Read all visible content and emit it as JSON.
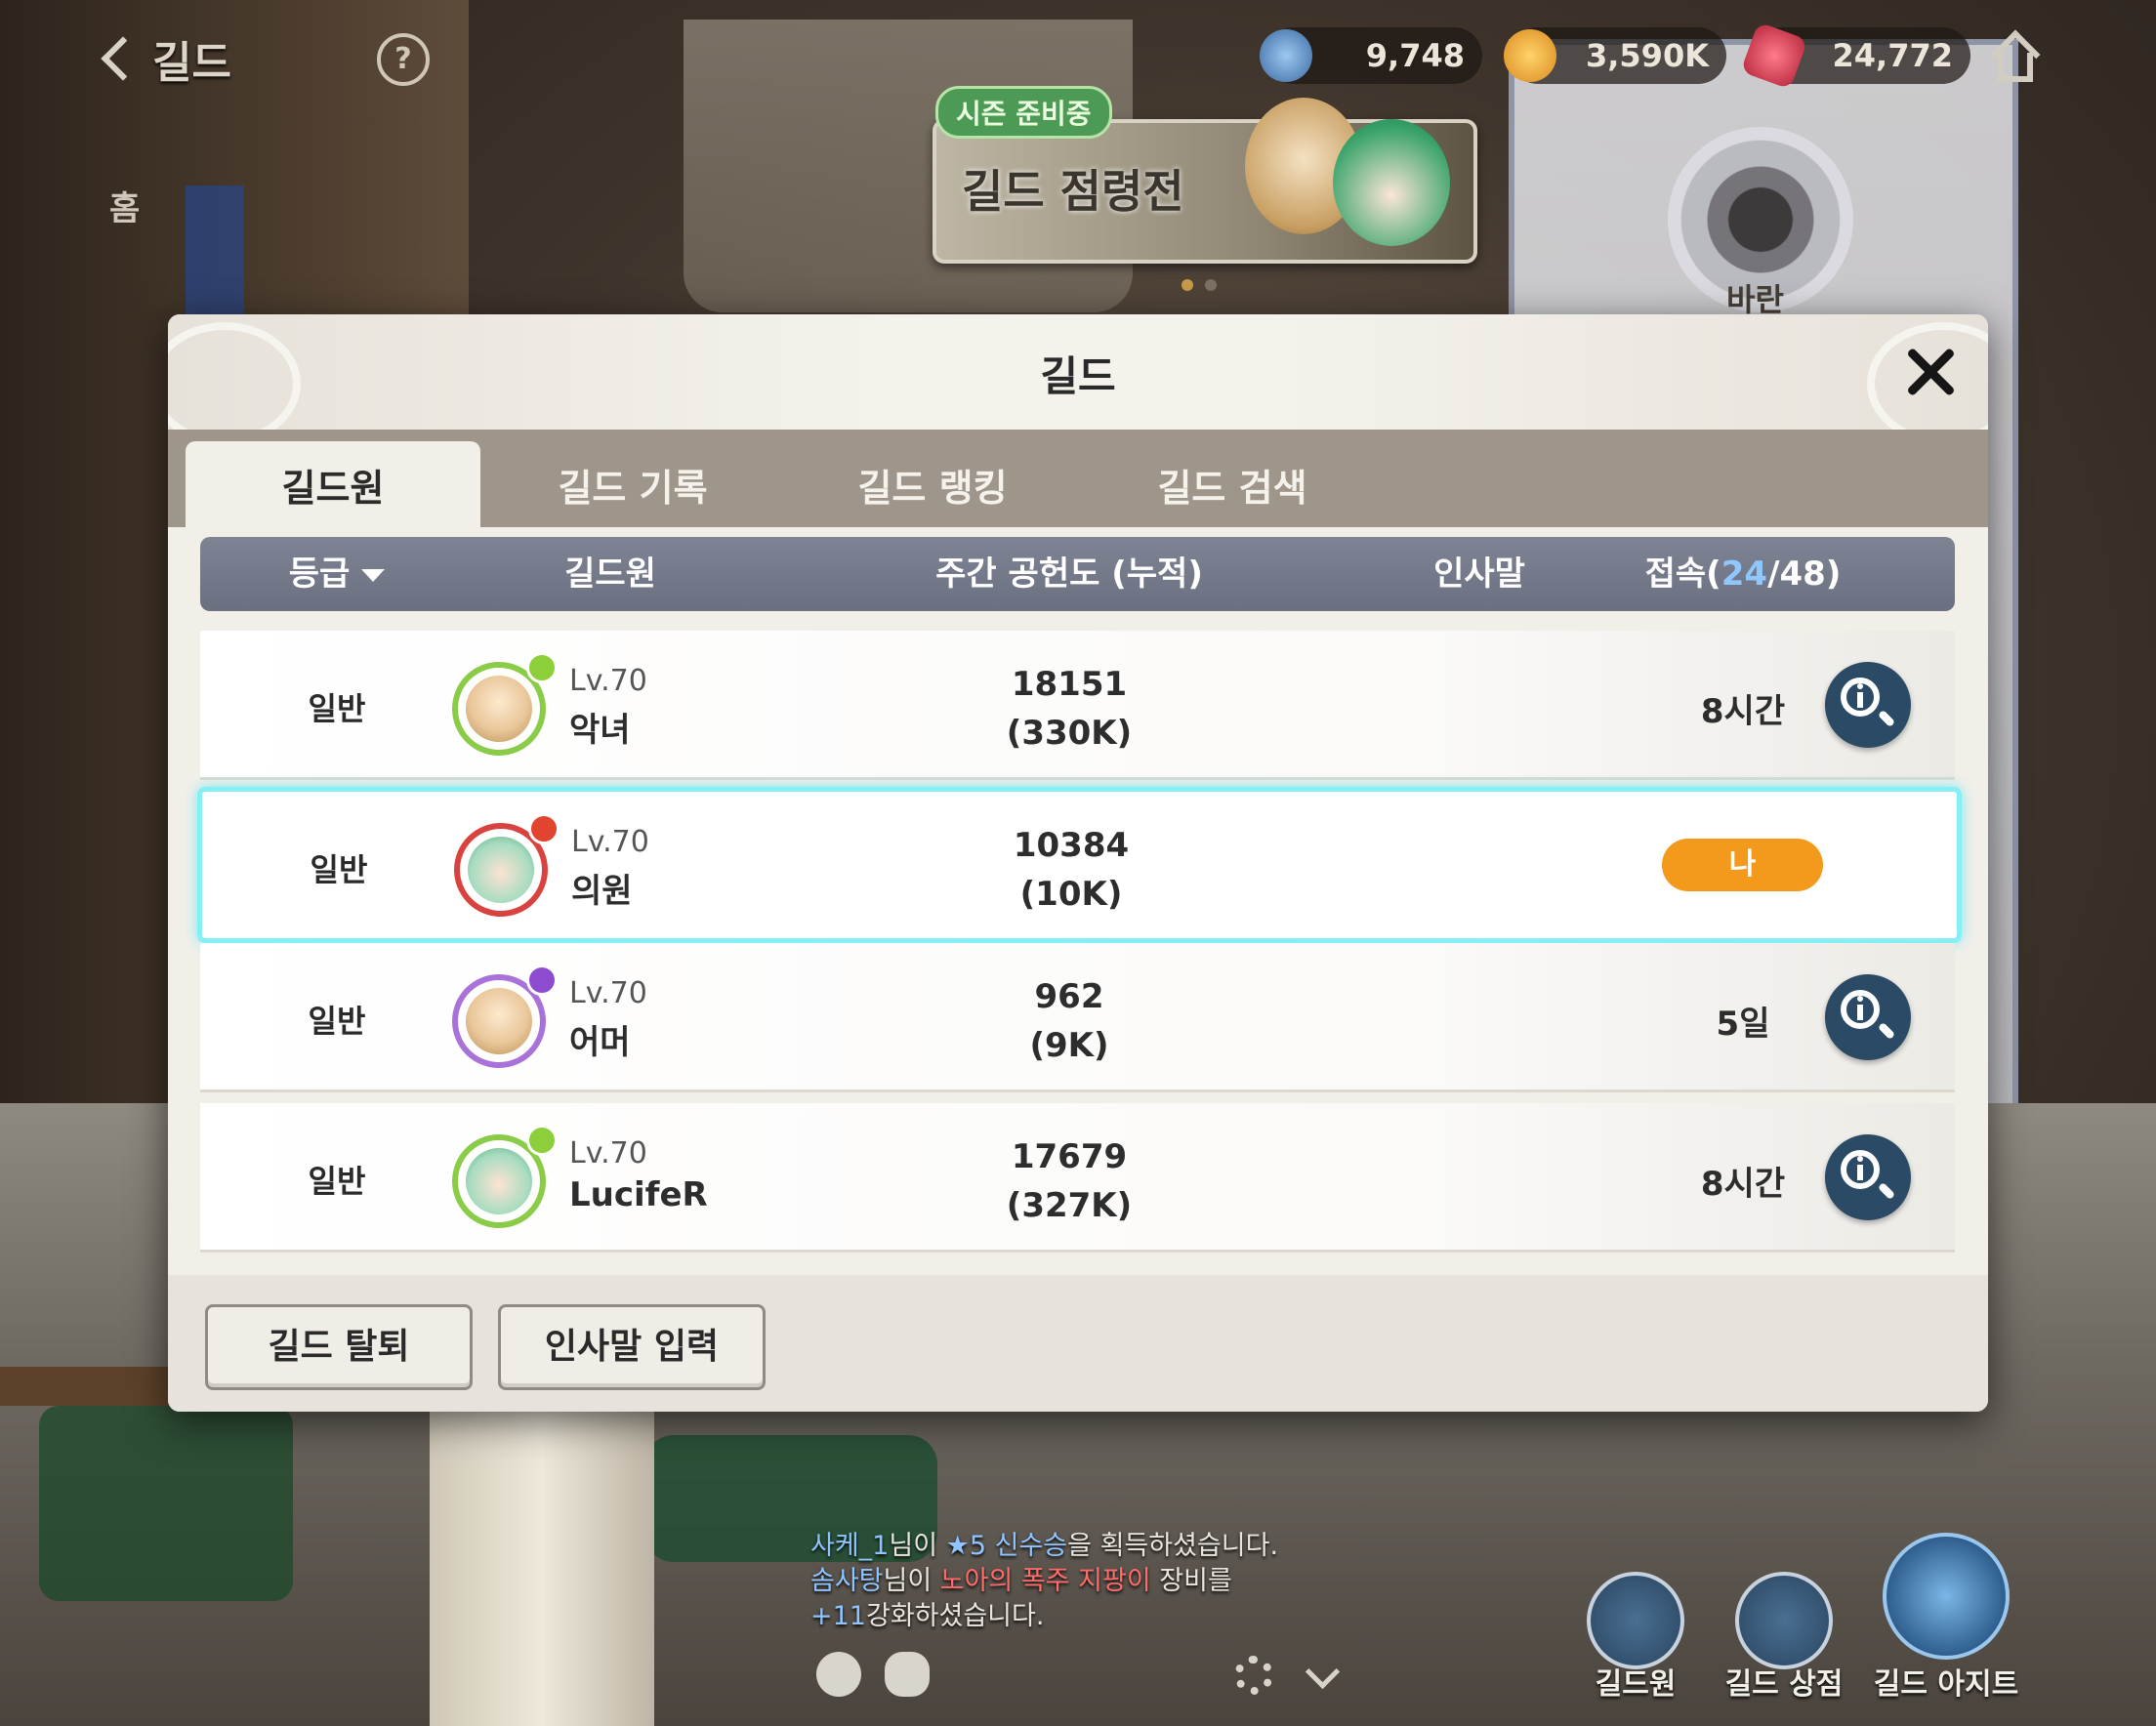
{
  "topbar": {
    "title": "길드",
    "currencies": [
      {
        "name": "stamina",
        "value": "9,748",
        "color": "#5a90c8"
      },
      {
        "name": "gold",
        "value": "3,590K",
        "color": "#d98a1e"
      },
      {
        "name": "gem",
        "value": "24,772",
        "color": "#b8263c"
      }
    ]
  },
  "season": {
    "badge": "시즌 준비중",
    "title": "길드 점령전"
  },
  "compass_label": "바란",
  "side_fragments": [
    "홈"
  ],
  "modal": {
    "title": "길드",
    "tabs": [
      {
        "label": "길드원",
        "active": true
      },
      {
        "label": "길드 기록",
        "active": false
      },
      {
        "label": "길드 랭킹",
        "active": false
      },
      {
        "label": "길드 검색",
        "active": false
      }
    ],
    "columns": {
      "rank": "등급",
      "member": "길드원",
      "weekly": "주간 공헌도 (누적)",
      "greeting": "인사말",
      "online_prefix": "접속(",
      "online_count": "24",
      "online_sep": "/",
      "online_total": "48",
      "online_suffix": ")"
    },
    "members": [
      {
        "rank": "일반",
        "level": "Lv.70",
        "name": "악녀",
        "weekly": "18151",
        "total": "(330K)",
        "last": "8시간",
        "frame": "#8acb48",
        "element": "#8ccf3a",
        "face": "#e9c79a"
      },
      {
        "rank": "일반",
        "level": "Lv.70",
        "name": "의원",
        "weekly": "10384",
        "total": "(10K)",
        "me": "나",
        "frame": "#d9433f",
        "element": "#e2452f",
        "face": "#a8dcc0"
      },
      {
        "rank": "일반",
        "level": "Lv.70",
        "name": "어머",
        "weekly": "962",
        "total": "(9K)",
        "last": "5일",
        "frame": "#a872d9",
        "element": "#8d4bd0",
        "face": "#e9c79a"
      },
      {
        "rank": "일반",
        "level": "Lv.70",
        "name": "LucifeR",
        "weekly": "17679",
        "total": "(327K)",
        "last": "8시간",
        "frame": "#8acb48",
        "element": "#8ccf3a",
        "face": "#a8dcc0"
      }
    ],
    "buttons": {
      "leave": "길드 탈퇴",
      "greeting": "인사말 입력"
    }
  },
  "chat": {
    "line1_name": "사케_1",
    "line1_a": "님이 ",
    "line1_star": "★5",
    "line1_item": "신수승",
    "line1_b": "을 획득하셨습니다.",
    "line2_name": "솜사탕",
    "line2_a": "님이 ",
    "line2_item": "노아의 폭주 지팡이",
    "line2_b": " 장비를",
    "line3_plus": "+11",
    "line3_b": "강화하셨습니다."
  },
  "bottom_nav": [
    {
      "label": "길드원"
    },
    {
      "label": "길드 상점"
    },
    {
      "label": "길드 아지트"
    }
  ]
}
